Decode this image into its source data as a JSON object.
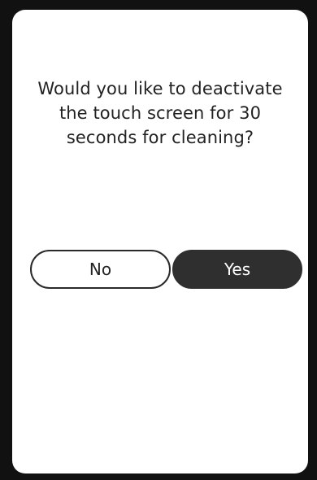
{
  "dialog": {
    "message": "Would you like to deactivate the touch screen for 30 seconds for cleaning?",
    "no_label": "No",
    "yes_label": "Yes"
  },
  "colors": {
    "background": "#111111",
    "panel": "#ffffff",
    "text": "#222222",
    "primary_button": "#2f2f2f"
  }
}
